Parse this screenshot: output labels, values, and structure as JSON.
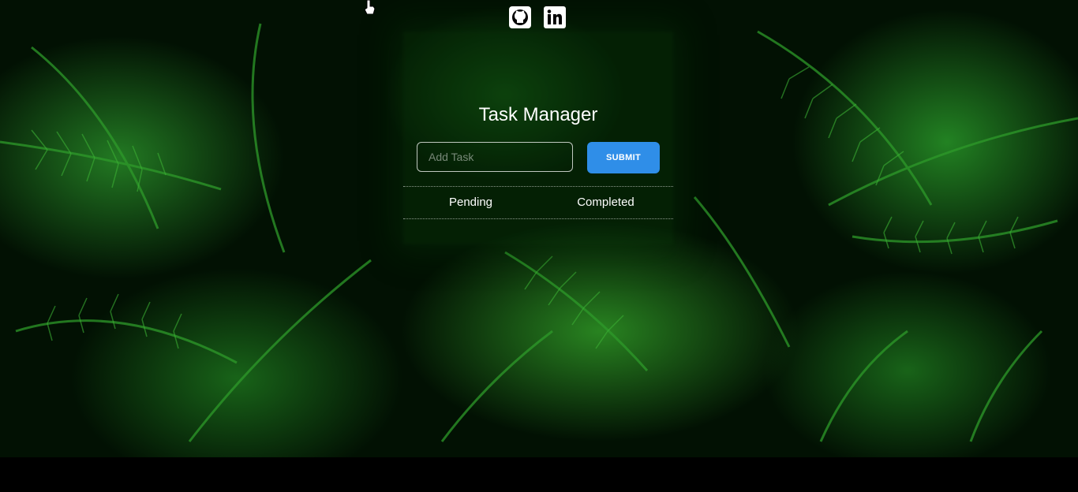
{
  "header": {
    "social": [
      {
        "icon": "github-icon",
        "label": "GitHub"
      },
      {
        "icon": "linkedin-icon",
        "label": "LinkedIn"
      }
    ]
  },
  "task_manager": {
    "title": "Task Manager",
    "input": {
      "value": "",
      "placeholder": "Add Task"
    },
    "submit_label": "SUBMIT",
    "tabs": [
      {
        "label": "Pending"
      },
      {
        "label": "Completed"
      }
    ]
  },
  "colors": {
    "accent": "#2f8ee8",
    "background": "#021103",
    "bottom_bar": "#000000",
    "text": "#ffffff"
  }
}
